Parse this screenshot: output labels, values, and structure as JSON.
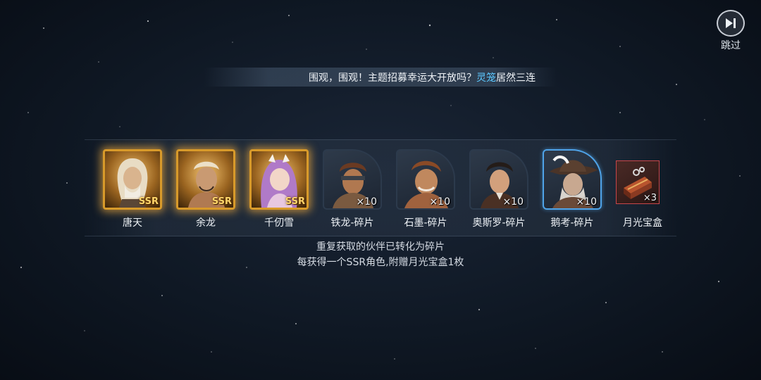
{
  "skip": {
    "label": "跳过",
    "icon": "skip-icon"
  },
  "banner": {
    "text_before": "围观，围观！主题招募幸运大开放吗？",
    "highlight": "灵笼",
    "text_after": "居然三连",
    "highlight_color": "#5cc8ff"
  },
  "rewards": [
    {
      "name": "唐天",
      "badge": "SSR",
      "type": "ssr"
    },
    {
      "name": "余龙",
      "badge": "SSR",
      "type": "ssr"
    },
    {
      "name": "千仞雪",
      "badge": "SSR",
      "type": "ssr"
    },
    {
      "name": "铁龙-碎片",
      "count": "×10",
      "type": "fragment"
    },
    {
      "name": "石墨-碎片",
      "count": "×10",
      "type": "fragment"
    },
    {
      "name": "奥斯罗-碎片",
      "count": "×10",
      "type": "fragment"
    },
    {
      "name": "鹅考-碎片",
      "count": "×10",
      "type": "fragment",
      "highlighted": true
    },
    {
      "name": "月光宝盒",
      "count": "×3",
      "type": "item"
    }
  ],
  "notes": {
    "line1": "重复获取的伙伴已转化为碎片",
    "line2": "每获得一个SSR角色,附赠月光宝盒1枚"
  },
  "colors": {
    "ssr_frame": "#d89a2a",
    "fragment_highlight": "#4fa3e8",
    "box_frame": "#c8464a"
  }
}
